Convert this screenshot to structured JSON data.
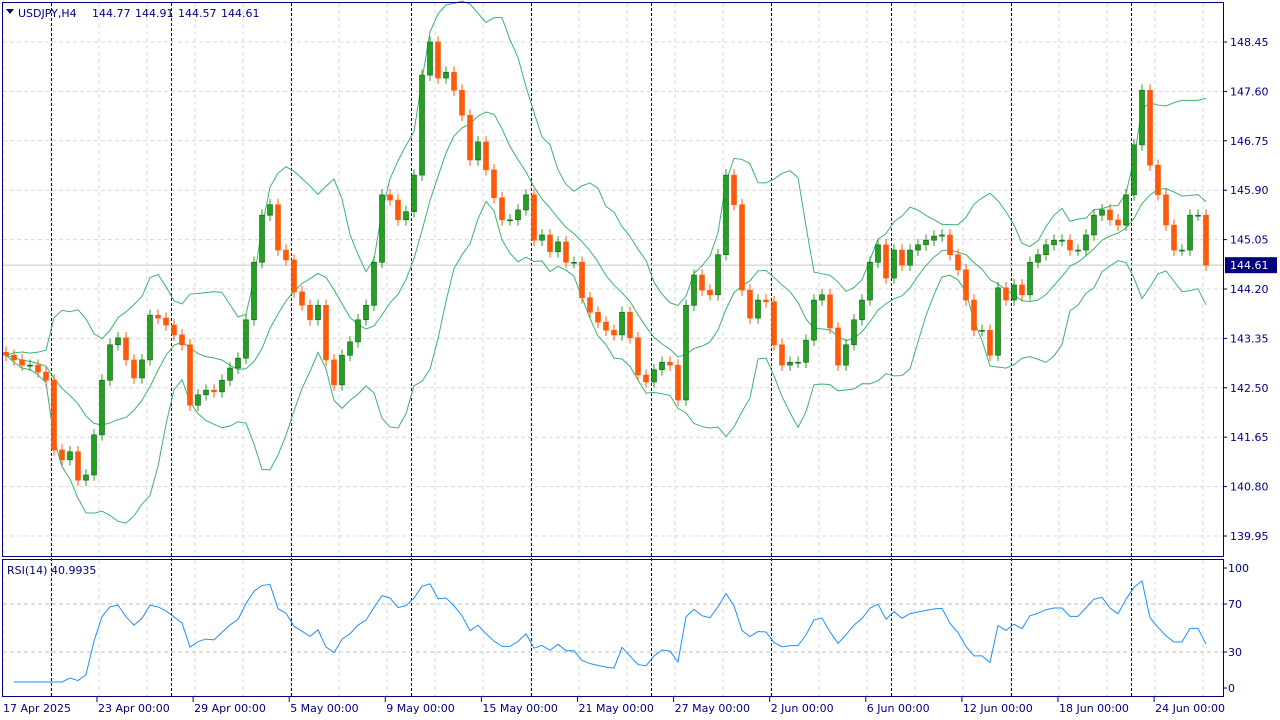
{
  "header": {
    "symbol": "USDJPY,H4",
    "open": "144.77",
    "high": "144.91",
    "low": "144.57",
    "close": "144.61"
  },
  "rsi_panel": {
    "label": "RSI(14) 40.9935"
  },
  "colors": {
    "frame": "#000080",
    "bull": "#22a022",
    "bear": "#ff5a0a",
    "bands": "#3cb371",
    "rsi": "#1e90ff",
    "grid": "#d8d8d8"
  },
  "chart_data": {
    "type": "candlestick",
    "title": "USDJPY,H4",
    "price_ticks": [
      "148.45",
      "147.60",
      "146.75",
      "145.90",
      "145.05",
      "144.20",
      "143.35",
      "142.50",
      "141.65",
      "140.80",
      "139.95"
    ],
    "ylim": [
      139.75,
      149.0
    ],
    "current_price": "144.61",
    "time_labels": [
      "17 Apr 2025",
      "23 Apr 00:00",
      "29 Apr 00:00",
      "5 May 00:00",
      "9 May 00:00",
      "15 May 00:00",
      "21 May 00:00",
      "27 May 00:00",
      "2 Jun 00:00",
      "6 Jun 00:00",
      "12 Jun 00:00",
      "18 Jun 00:00",
      "24 Jun 00:00"
    ],
    "rsi_ticks": [
      "100",
      "70",
      "30",
      "0"
    ],
    "rsi_levels": [
      70,
      30
    ],
    "indicators": [
      "Bollinger Bands",
      "RSI(14)"
    ],
    "closes": [
      143.06,
      142.98,
      142.89,
      142.89,
      142.77,
      142.63,
      141.43,
      141.26,
      141.4,
      140.91,
      141.0,
      141.69,
      142.63,
      143.24,
      143.36,
      142.98,
      142.67,
      142.98,
      143.75,
      143.7,
      143.58,
      143.41,
      143.24,
      142.2,
      142.38,
      142.46,
      142.43,
      142.63,
      142.84,
      143.01,
      143.67,
      144.66,
      145.47,
      145.65,
      144.87,
      144.7,
      144.15,
      143.92,
      143.67,
      143.92,
      142.98,
      142.55,
      143.06,
      143.29,
      143.67,
      143.92,
      144.66,
      145.82,
      145.73,
      145.39,
      145.53,
      146.16,
      147.88,
      148.45,
      147.83,
      147.93,
      147.62,
      147.19,
      146.42,
      146.73,
      146.25,
      145.77,
      145.39,
      145.39,
      145.56,
      145.82,
      145.04,
      145.13,
      144.84,
      145.01,
      144.66,
      144.66,
      144.05,
      143.8,
      143.63,
      143.49,
      143.41,
      143.8,
      143.36,
      142.72,
      142.6,
      142.81,
      142.94,
      142.89,
      142.29,
      143.92,
      144.44,
      144.18,
      144.1,
      144.79,
      146.16,
      145.65,
      144.18,
      143.7,
      144.01,
      143.98,
      143.24,
      142.89,
      142.94,
      142.94,
      143.32,
      144.01,
      144.1,
      143.53,
      142.89,
      143.24,
      143.67,
      144.01,
      144.66,
      144.96,
      144.39,
      144.87,
      144.61,
      144.87,
      144.96,
      145.04,
      145.11,
      145.13,
      144.79,
      144.53,
      144.01,
      143.49,
      143.49,
      143.06,
      144.22,
      144.01,
      144.27,
      144.1,
      144.66,
      144.79,
      144.96,
      145.04,
      145.04,
      144.87,
      144.87,
      145.13,
      145.47,
      145.56,
      145.39,
      145.3,
      145.82,
      146.68,
      147.62,
      146.33,
      145.82,
      145.3,
      144.87,
      144.87,
      145.47,
      145.47,
      144.61
    ]
  }
}
